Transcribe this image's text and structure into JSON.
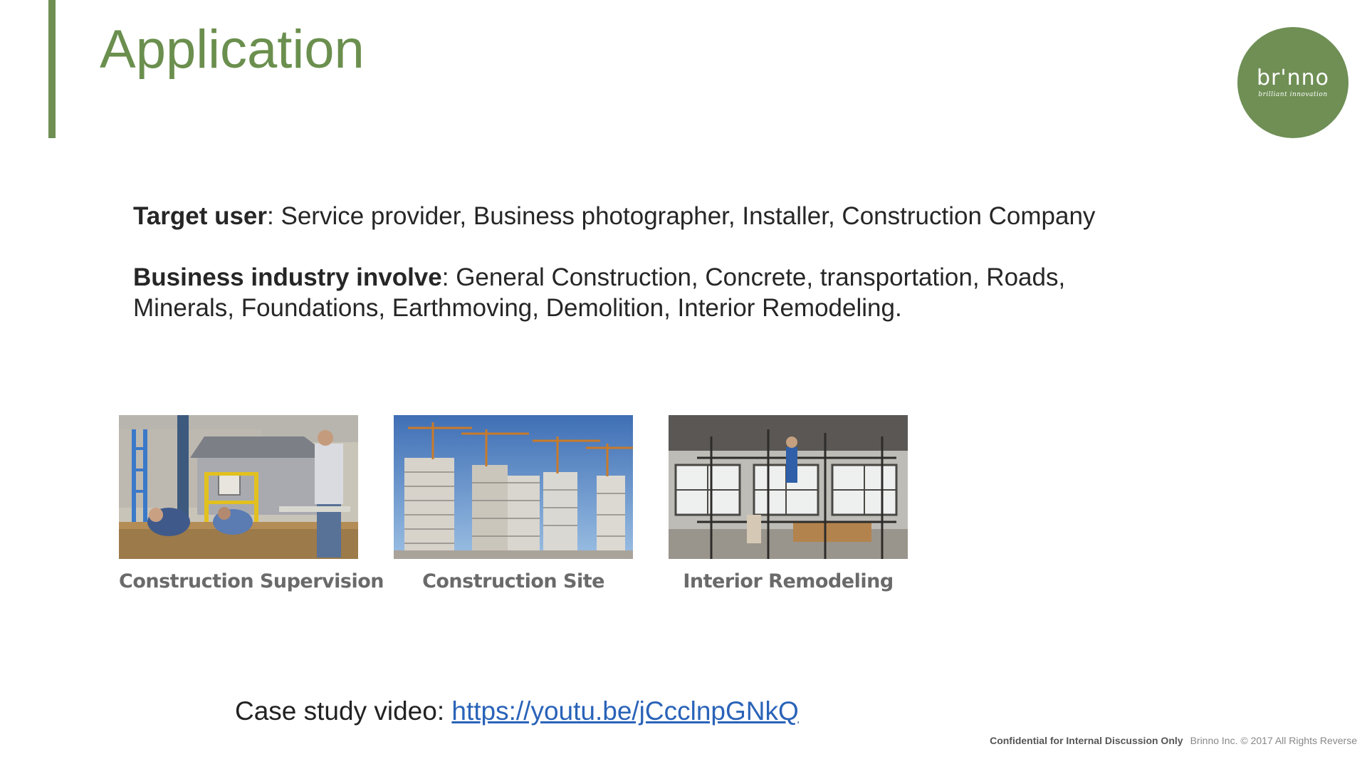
{
  "slide": {
    "title": "Application",
    "brand": {
      "name": "br'nno",
      "tagline": "brilliant innovation"
    }
  },
  "content": {
    "target": {
      "label": "Target user",
      "text": ": Service provider, Business photographer, Installer, Construction Company"
    },
    "industry": {
      "label": "Business industry involve",
      "text": ": General Construction, Concrete, transportation, Roads, Minerals, Foundations, Earthmoving, Demolition, Interior Remodeling."
    }
  },
  "gallery": [
    {
      "caption": "Construction Supervision",
      "icon": "construction-workers-photo"
    },
    {
      "caption": "Construction Site",
      "icon": "highrise-cranes-photo"
    },
    {
      "caption": "Interior Remodeling",
      "icon": "scaffolding-interior-photo"
    }
  ],
  "case_study": {
    "label": "Case study video: ",
    "url": "https://youtu.be/jCcclnpGNkQ"
  },
  "footer": {
    "confidential": "Confidential for Internal Discussion Only",
    "rights": "Brinno Inc. © 2017 All Rights Reverse"
  },
  "colors": {
    "accent": "#6f8f55",
    "title": "#6b8f4e",
    "link": "#2a63b8",
    "caption": "#6a6a6a"
  }
}
